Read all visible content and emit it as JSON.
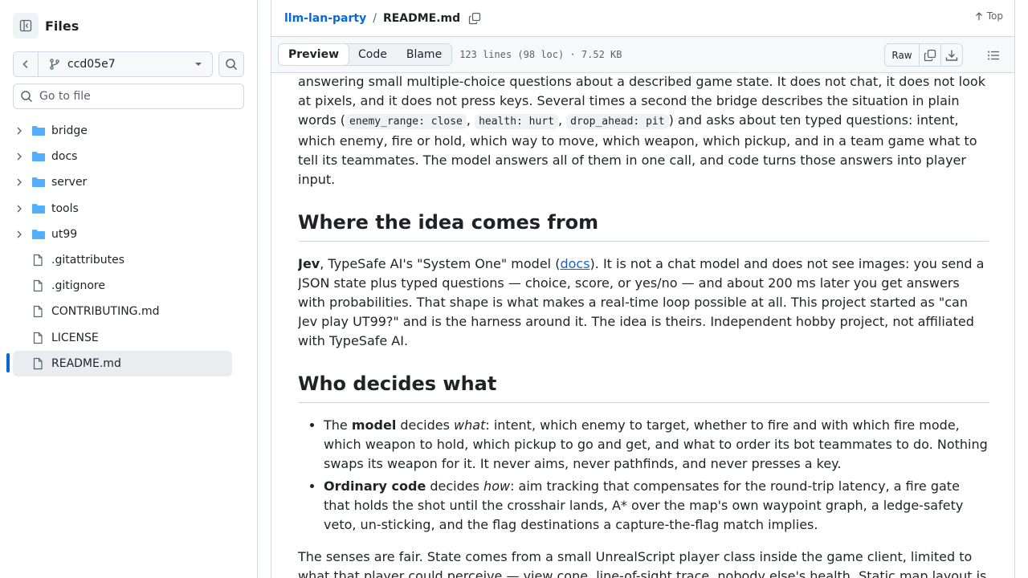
{
  "sidebar": {
    "title": "Files",
    "branch": "ccd05e7",
    "goto_placeholder": "Go to file",
    "items": [
      {
        "name": "bridge",
        "type": "folder"
      },
      {
        "name": "docs",
        "type": "folder"
      },
      {
        "name": "server",
        "type": "folder"
      },
      {
        "name": "tools",
        "type": "folder"
      },
      {
        "name": "ut99",
        "type": "folder"
      },
      {
        "name": ".gitattributes",
        "type": "file"
      },
      {
        "name": ".gitignore",
        "type": "file"
      },
      {
        "name": "CONTRIBUTING.md",
        "type": "file"
      },
      {
        "name": "LICENSE",
        "type": "file"
      },
      {
        "name": "README.md",
        "type": "file",
        "selected": true
      }
    ]
  },
  "breadcrumb": {
    "repo": "llm-lan-party",
    "separator": "/",
    "file": "README.md",
    "top_label": "Top"
  },
  "toolbar": {
    "tabs": [
      "Preview",
      "Code",
      "Blame"
    ],
    "active_tab": "Preview",
    "file_info": "123 lines (98 loc) · 7.52 KB",
    "raw_label": "Raw"
  },
  "content": {
    "p1": {
      "t1": "answering small multiple-choice questions about a described game state. It does not chat, it does not look at pixels, and it does not press keys. Several times a second the bridge describes the situation in plain words (",
      "c1": "enemy_range: close",
      "s1": ", ",
      "c2": "health: hurt",
      "s2": ", ",
      "c3": "drop_ahead: pit",
      "t2": ") and asks about ten typed questions: intent, which enemy, fire or hold, which way to move, which weapon, which pickup, and in a team game what to tell its teammates. The model answers all of them in one call, and code turns those answers into player input."
    },
    "h_idea": "Where the idea comes from",
    "p2": {
      "b1": "Jev",
      "t1": ", TypeSafe AI's \"System One\" model (",
      "link": "docs",
      "t2": "). It is not a chat model and does not see images: you send a JSON state plus typed questions — choice, score, or yes/no — and about 200 ms later you get answers with probabilities. That shape is what makes a real-time loop possible at all. This project started as \"can Jev play UT99?\" and is the harness around it. The idea is theirs. Independent hobby project, not affiliated with TypeSafe AI."
    },
    "h_who": "Who decides what",
    "bullets": [
      {
        "pre": "The ",
        "bold": "model",
        "mid": " decides ",
        "em": "what",
        "post": ": intent, which enemy to target, whether to fire and with which fire mode, which weapon to hold, which pickup to go and get, and what to order its bot teammates to do. Nothing swaps its weapon for it. It never aims, never pathfinds, and never presses a key."
      },
      {
        "pre": "",
        "bold": "Ordinary code",
        "mid": " decides ",
        "em": "how",
        "post": ": aim tracking that compensates for the round-trip latency, a fire gate that holds the shot until the crosshair lands, A* over the map's own waypoint graph, a ledge-safety veto, un-sticking, and the flag destinations a capture-the-flag match implies."
      }
    ],
    "p3": "The senses are fair. State comes from a small UnrealScript player class inside the game client, limited to what that player could perceive — view cone, line-of-sight trace, nobody else's health. Static map layout is"
  },
  "colors": {
    "accent": "#0969da",
    "folder": "#54aeff",
    "border": "#d1d9e0",
    "muted": "#59636e"
  }
}
